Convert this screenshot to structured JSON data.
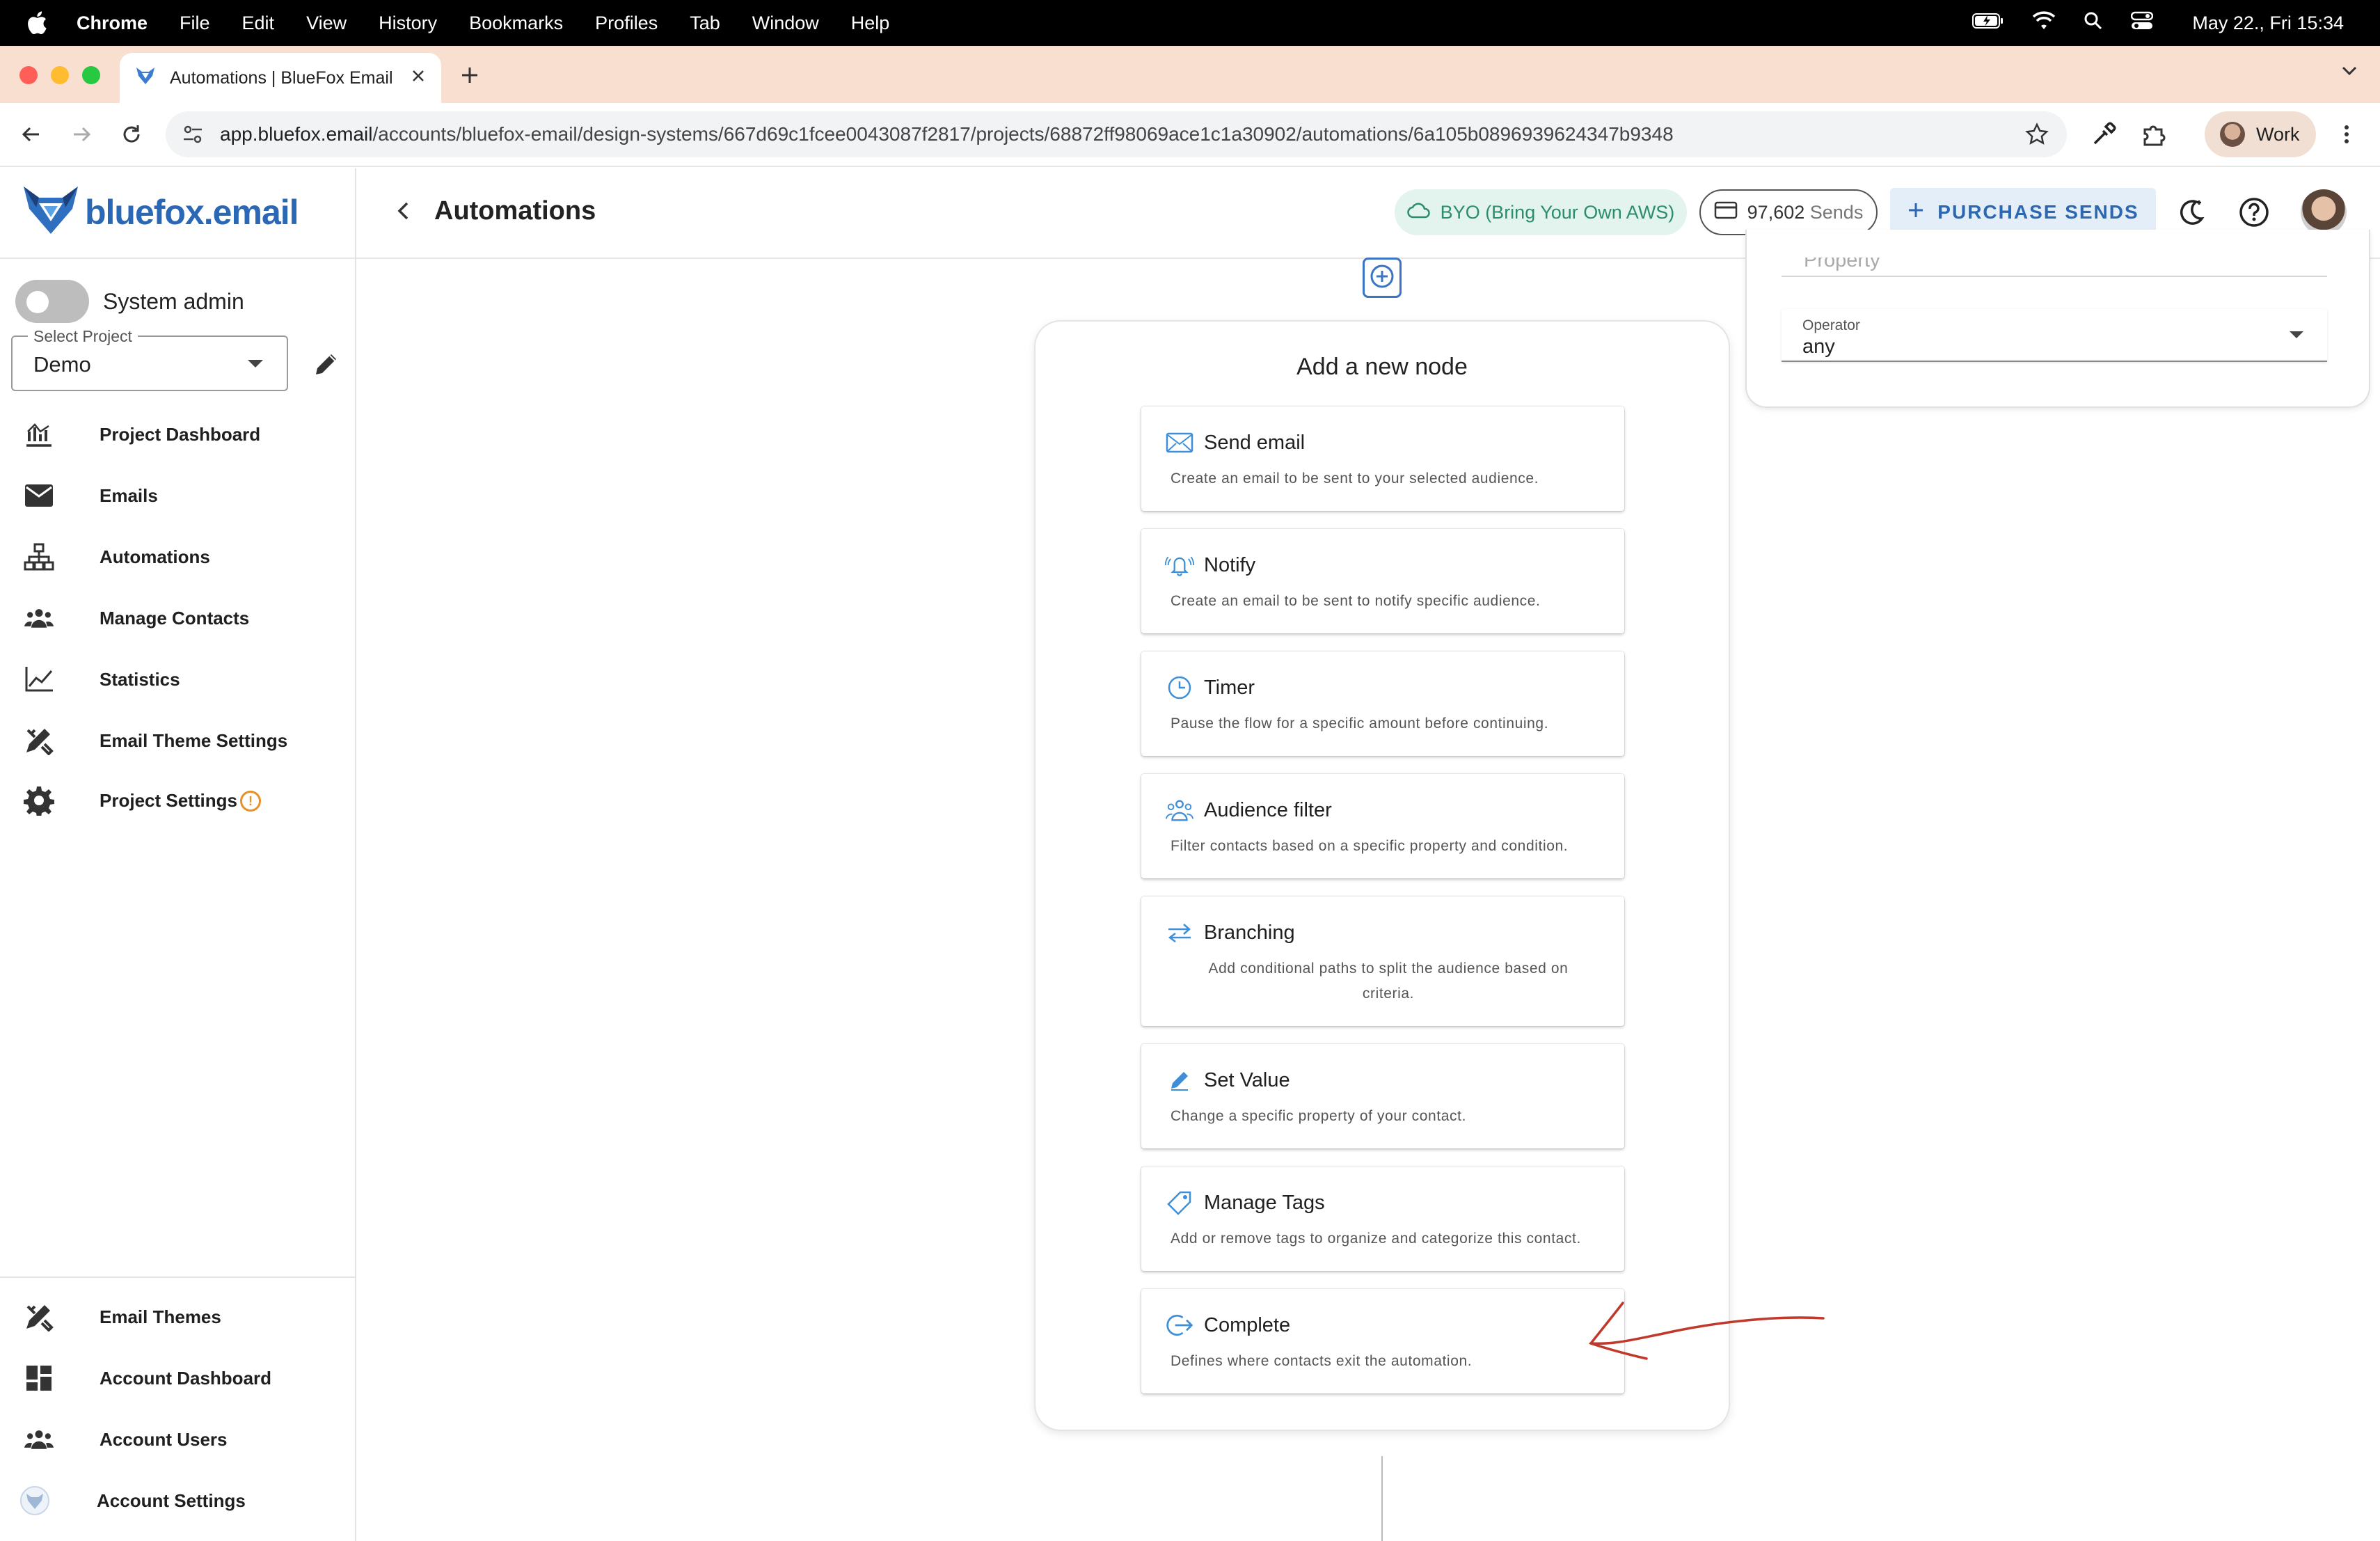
{
  "menubar": {
    "app": "Chrome",
    "items": [
      "File",
      "Edit",
      "View",
      "History",
      "Bookmarks",
      "Profiles",
      "Tab",
      "Window",
      "Help"
    ],
    "clock": "May 22., Fri 15:34"
  },
  "browser": {
    "tab_title": "Automations | BlueFox Email",
    "url_host": "app.bluefox.email",
    "url_path": "/accounts/bluefox-email/design-systems/667d69c1fcee0043087f2817/projects/68872ff98069ace1c1a30902/automations/6a105b0896939624347b9348",
    "profile": "Work"
  },
  "header": {
    "logo": "bluefox.email",
    "title": "Automations",
    "byo": "BYO (Bring Your Own AWS)",
    "sends_count": "97,602",
    "sends_label": "Sends",
    "purchase": "PURCHASE SENDS"
  },
  "sidebar": {
    "system_admin": "System admin",
    "project_select_label": "Select Project",
    "project_value": "Demo",
    "items": [
      {
        "label": "Project Dashboard",
        "icon": "dashboard-chart-icon"
      },
      {
        "label": "Emails",
        "icon": "mail-icon"
      },
      {
        "label": "Automations",
        "icon": "sitemap-icon"
      },
      {
        "label": "Manage Contacts",
        "icon": "contacts-icon"
      },
      {
        "label": "Statistics",
        "icon": "line-chart-icon"
      },
      {
        "label": "Email Theme Settings",
        "icon": "design-tools-icon"
      },
      {
        "label": "Project Settings",
        "icon": "gear-icon",
        "badge": "!"
      }
    ],
    "bottom_items": [
      {
        "label": "Email Themes",
        "icon": "design-tools-icon"
      },
      {
        "label": "Account Dashboard",
        "icon": "dashboard-grid-icon"
      },
      {
        "label": "Account Users",
        "icon": "users-icon"
      },
      {
        "label": "Account Settings",
        "icon": "account-logo-icon"
      }
    ]
  },
  "panel": {
    "title": "Add a new node",
    "nodes": [
      {
        "title": "Send email",
        "desc": "Create an email to be sent to your selected audience.",
        "icon": "envelope-icon"
      },
      {
        "title": "Notify",
        "desc": "Create an email to be sent to notify specific audience.",
        "icon": "ringing-bell-icon"
      },
      {
        "title": "Timer",
        "desc": "Pause the flow for a specific amount before continuing.",
        "icon": "clock-icon"
      },
      {
        "title": "Audience filter",
        "desc": "Filter contacts based on a specific property and condition.",
        "icon": "audience-filter-icon"
      },
      {
        "title": "Branching",
        "desc": "Add conditional paths to split the audience based on criteria.",
        "icon": "branch-arrows-icon"
      },
      {
        "title": "Set Value",
        "desc": "Change a specific property of your contact.",
        "icon": "pencil-icon"
      },
      {
        "title": "Manage Tags",
        "desc": "Add or remove tags to organize and categorize this contact.",
        "icon": "tag-icon"
      },
      {
        "title": "Complete",
        "desc": "Defines where contacts exit the automation.",
        "icon": "exit-icon"
      }
    ]
  },
  "properties": {
    "top_field_value": "Property",
    "operator_label": "Operator",
    "operator_value": "any"
  },
  "colors": {
    "brand_blue": "#2b68b1",
    "icon_blue": "#3f8fd8",
    "byo_green": "#2c8d6e",
    "warning_orange": "#e8902a",
    "annotation_red": "#c0392b",
    "tabstrip": "#f9dfcf"
  }
}
